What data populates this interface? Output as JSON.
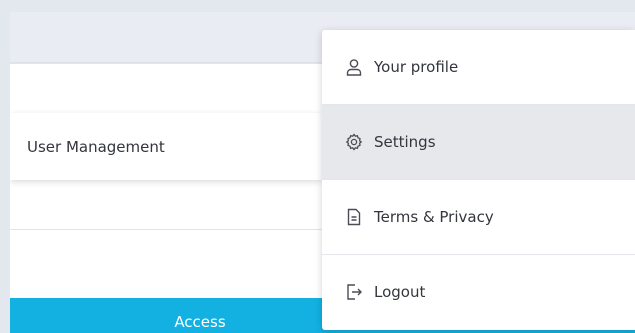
{
  "left_menu": {
    "item_label": "User Management"
  },
  "bottom_bar": {
    "label": "Access",
    "color": "#12b1e2"
  },
  "dropdown": {
    "items": [
      {
        "label": "Your profile",
        "icon": "user-icon"
      },
      {
        "label": "Settings",
        "icon": "gear-icon"
      },
      {
        "label": "Terms & Privacy",
        "icon": "document-icon"
      },
      {
        "label": "Logout",
        "icon": "logout-icon"
      }
    ],
    "highlight_color": "#e6e8ec"
  }
}
